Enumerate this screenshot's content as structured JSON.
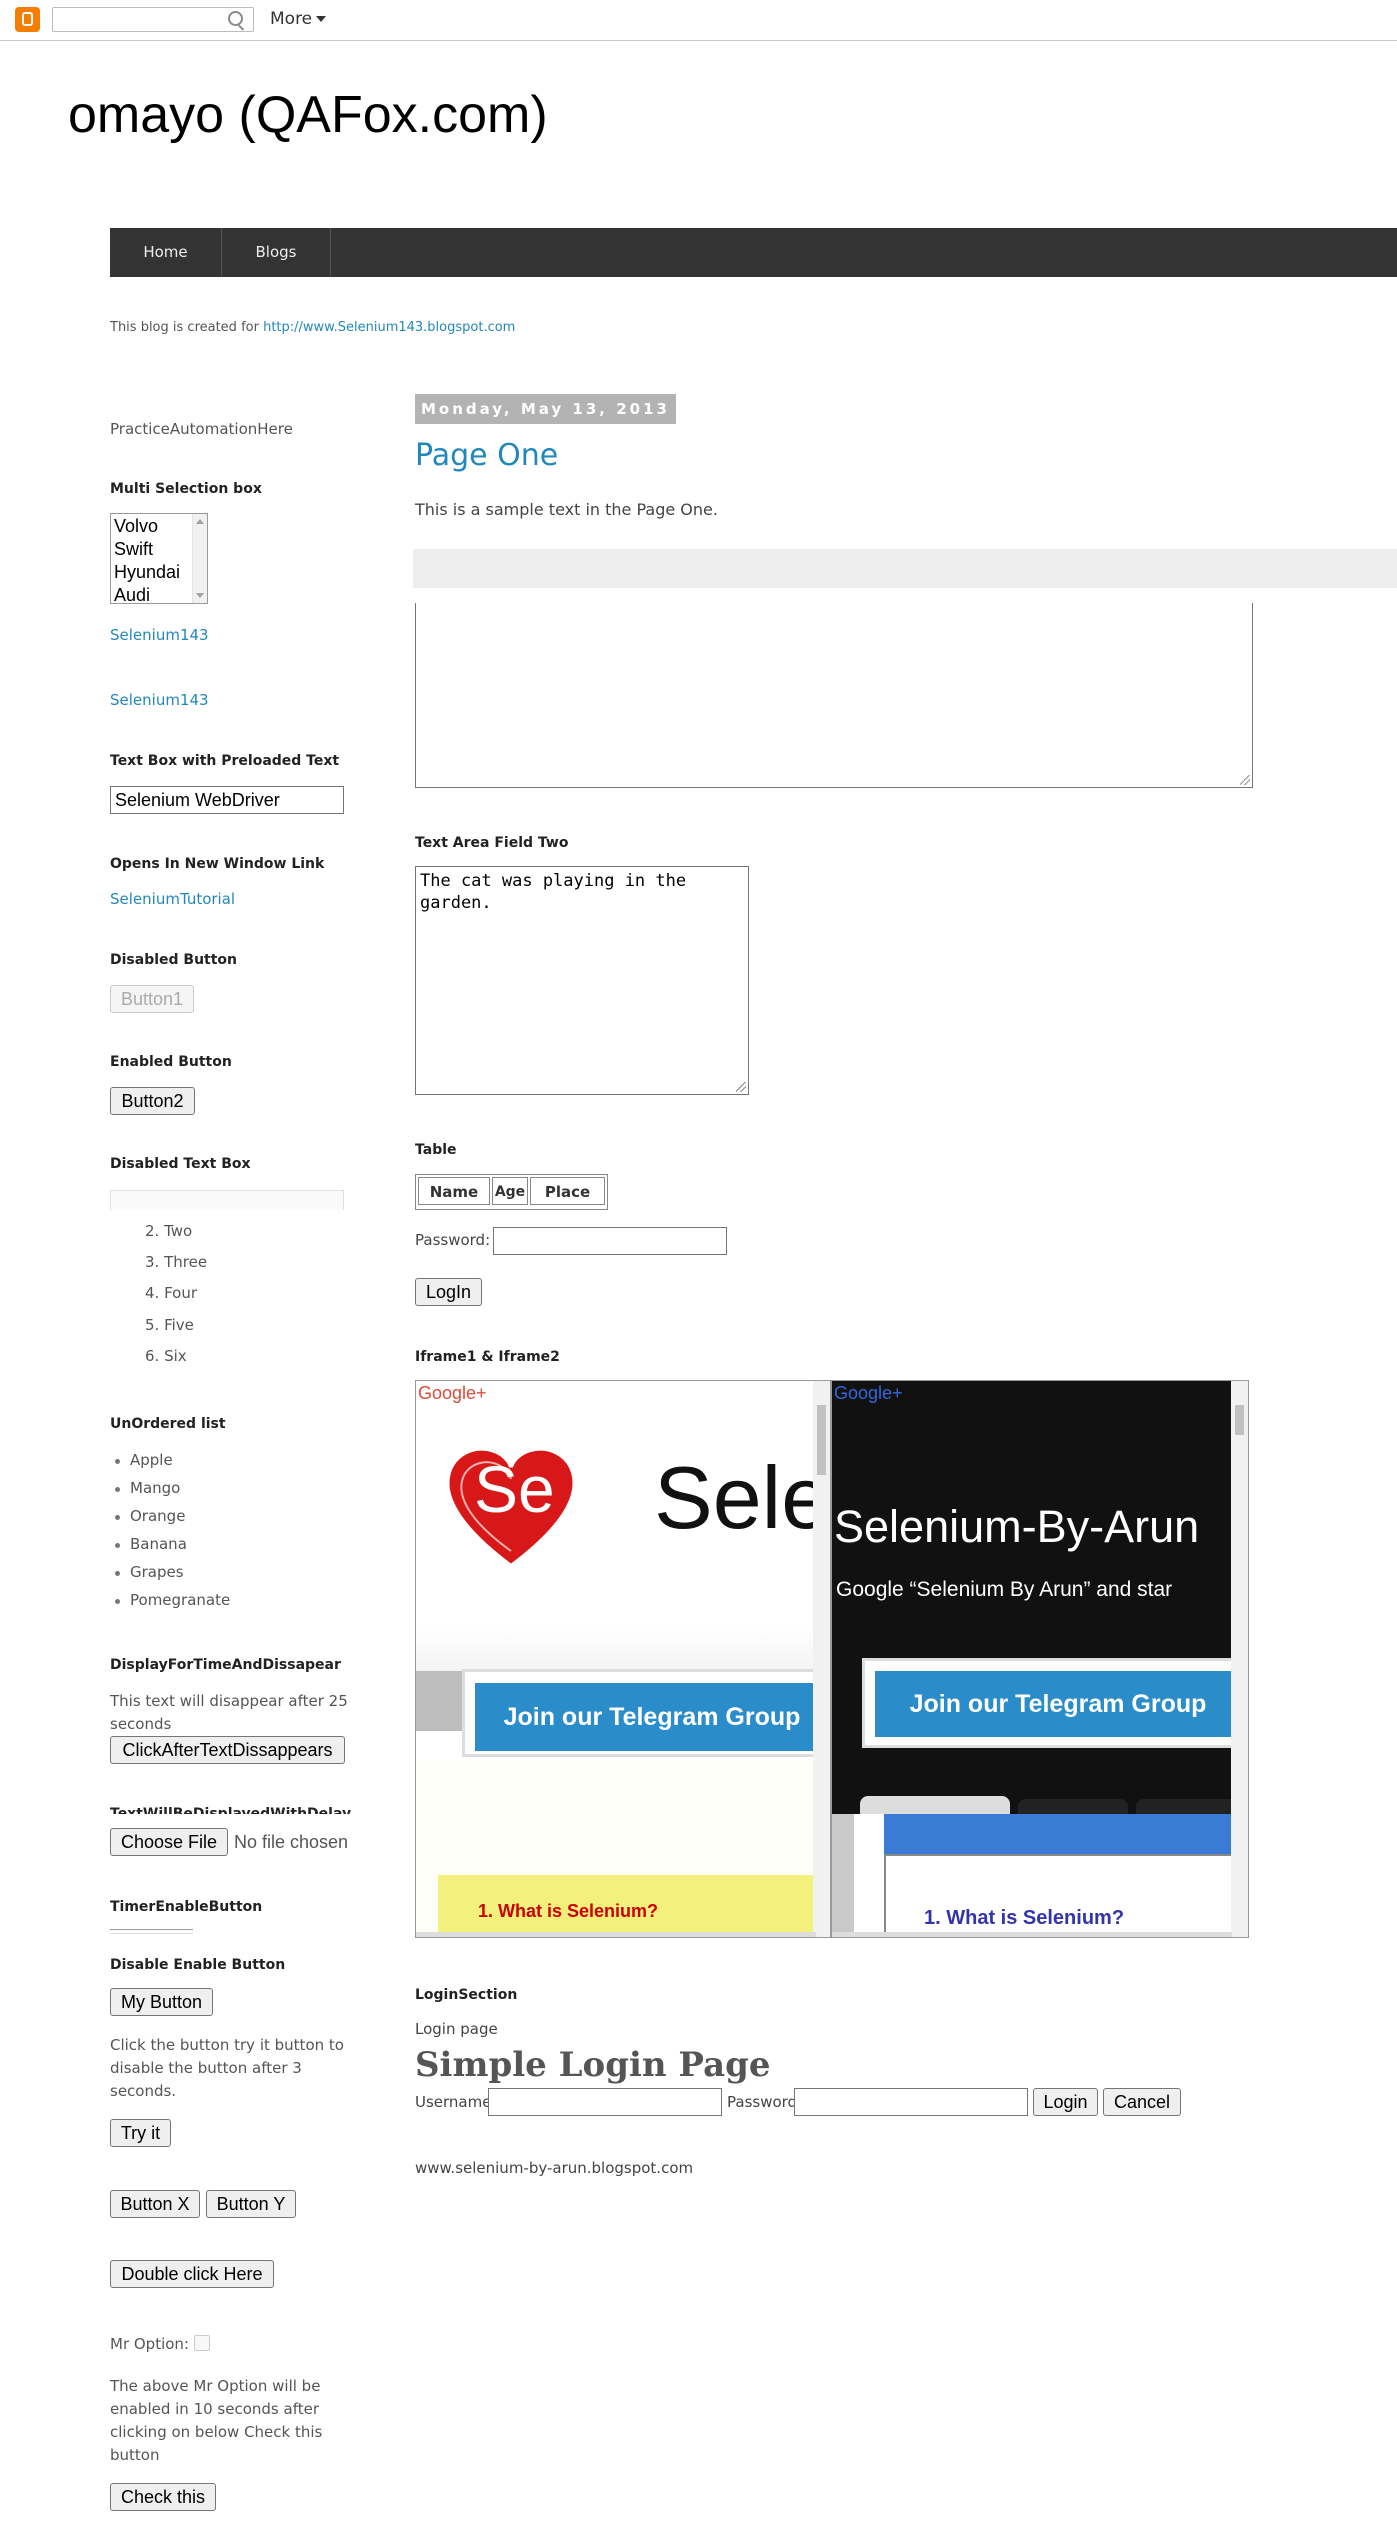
{
  "navbar": {
    "search_placeholder": "",
    "more_label": "More"
  },
  "blog": {
    "title": "omayo (QAFox.com)",
    "nav": [
      "Home",
      "Blogs"
    ],
    "description_prefix": "This blog is created for ",
    "description_link": "http://www.Selenium143.blogspot.com"
  },
  "sidebar": {
    "practice_heading": "PracticeAutomationHere",
    "multi_select_label": "Multi Selection box",
    "multi_select_options": [
      "Volvo",
      "Swift",
      "Hyundai",
      "Audi"
    ],
    "link1": "Selenium143",
    "link2": "Selenium143",
    "preloaded_label": "Text Box with Preloaded Text",
    "preloaded_value": "Selenium WebDriver",
    "new_window_label": "Opens In New Window Link",
    "new_window_link": "SeleniumTutorial",
    "disabled_btn_label": "Disabled Button",
    "disabled_btn": "Button1",
    "enabled_btn_label": "Enabled Button",
    "enabled_btn": "Button2",
    "disabled_textbox_label": "Disabled Text Box",
    "ordered_items": [
      "2. Two",
      "3. Three",
      "4. Four",
      "5. Five",
      "6. Six"
    ],
    "unordered_label": "UnOrdered list",
    "unordered_items": [
      "Apple",
      "Mango",
      "Orange",
      "Banana",
      "Grapes",
      "Pomegranate"
    ],
    "display_time_label": "DisplayForTimeAndDissapear",
    "disappear_text": "This text will disappear after 25 seconds",
    "click_after_btn": "ClickAfterTextDissappears",
    "delayed_label": "TextWillBeDisplayedWithDelay",
    "choose_file_btn": "Choose File",
    "no_file": "No file chosen",
    "timer_label": "TimerEnableButton",
    "disable_enable_label": "Disable Enable Button",
    "my_button": "My Button",
    "try_it_desc": "Click the button try it button to disable the button after 3 seconds.",
    "try_it_btn": "Try it",
    "button_x": "Button X",
    "button_y": "Button Y",
    "double_click_btn": "Double click Here",
    "mr_option_label": "Mr Option:",
    "mr_option_desc": "The above Mr Option will be enabled in 10 seconds after clicking on below Check this button",
    "check_this_btn": "Check this"
  },
  "main": {
    "date": "Monday, May 13, 2013",
    "post_title": "Page One",
    "post_text": "This is a sample text in the Page One.",
    "textarea_two_label": "Text Area Field Two",
    "textarea_two_value": "The cat was playing in the garden.",
    "table_label": "Table",
    "table_headers": [
      "Name",
      "Age",
      "Place"
    ],
    "password_label": "Password:",
    "login_btn": "LogIn",
    "iframe_label": "Iframe1 & Iframe2",
    "iframe1": {
      "google_plus": "Google+",
      "logo_text": "Se",
      "brand_text": "Sele",
      "telegram": "Join our Telegram Group",
      "question": "1. What is Selenium?"
    },
    "iframe2": {
      "google_plus": "Google+",
      "brand_text": "Selenium-By-Arun",
      "subtitle": "Google “Selenium By Arun” and star",
      "telegram": "Join our Telegram Group",
      "question": "1. What is Selenium?"
    },
    "login_section_label": "LoginSection",
    "login_page_text": "Login page",
    "login_title": "Simple Login Page",
    "username_label": "Username",
    "password2_label": "Password",
    "login2_btn": "Login",
    "cancel_btn": "Cancel",
    "footer_url": "www.selenium-by-arun.blogspot.com"
  },
  "colors": {
    "link": "#2288bb",
    "nav_bg": "#333333",
    "telegram": "#2a8cc9",
    "iframe1_question": "#cc0000",
    "iframe2_question": "#3333aa"
  }
}
